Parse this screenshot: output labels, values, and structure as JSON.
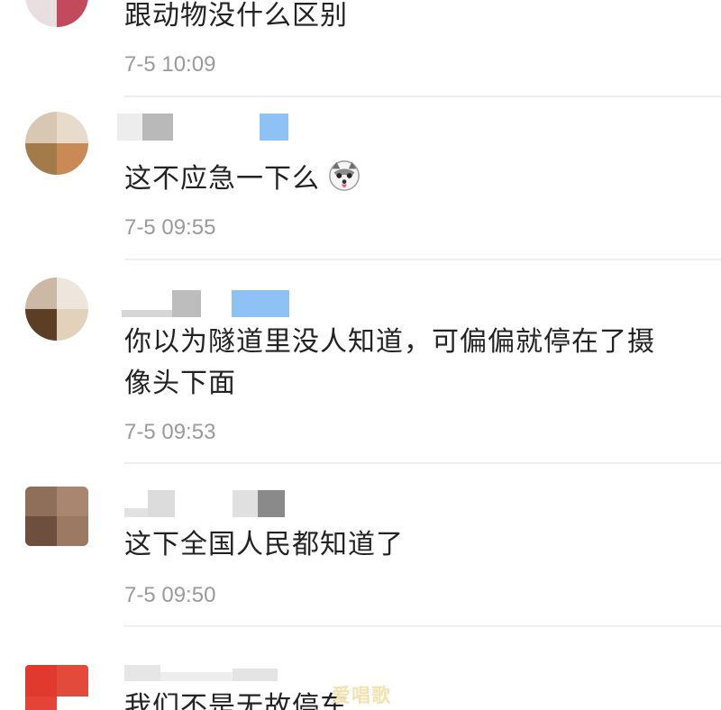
{
  "comments": [
    {
      "text": "跟动物没什么区别",
      "time": "7-5 10:09"
    },
    {
      "text": "这不应急一下么",
      "emoji": "husky-dog-emoji",
      "time": "7-5 09:55"
    },
    {
      "text_line1": "你以为隧道里没人知道，可偏偏就停在了摄",
      "text_line2": "像头下面",
      "time": "7-5 09:53"
    },
    {
      "text": "这下全国人民都知道了",
      "time": "7-5 09:50"
    },
    {
      "text": "我们不是无故停车"
    }
  ],
  "watermark": "爱唱歌",
  "colors": {
    "text": "#222222",
    "time": "#9a9a9a",
    "divider": "#eeeeee",
    "blur_blue": "#8ec2f5",
    "avatar_red": "#e03a2e"
  }
}
